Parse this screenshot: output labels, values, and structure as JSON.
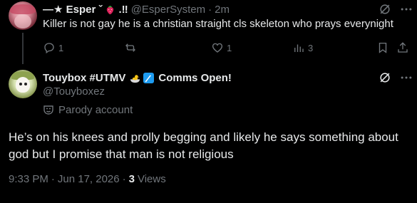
{
  "parent_tweet": {
    "display_name": "—★ Esper ˇ",
    "name_suffix": ".‼",
    "handle": "@EsperSystem",
    "time": "2m",
    "text": "Killer is not gay he is a christian straight cls skeleton who prays everynight",
    "replies": "1",
    "reposts": "",
    "likes": "1",
    "views": "3",
    "icons": {
      "reply": "reply-icon",
      "repost": "repost-icon",
      "like": "like-icon",
      "views": "views-icon",
      "bookmark": "bookmark-icon",
      "share": "share-icon",
      "grok": "grok-icon",
      "more": "more-icon",
      "emoji": "strawberry-icon"
    }
  },
  "main_tweet": {
    "display_name": "Touybox #UTMV",
    "name_suffix": "Comms Open!",
    "handle": "@Touyboxez",
    "label": "Parody account",
    "text": "He’s on his knees and prolly begging and likely he says something about god but I promise that man is not religious",
    "time": "9:33 PM",
    "date": "Jun 17, 2026",
    "views_count": "3",
    "views_label": "Views",
    "icons": {
      "emoji1": "duck-bath-icon",
      "emoji2": "paint-brush-icon",
      "label": "parody-mask-icon",
      "grok": "grok-icon",
      "more": "more-icon"
    }
  },
  "colors": {
    "background": "#000000",
    "text": "#e7e9ea",
    "muted": "#71767b",
    "thread_line": "#333639"
  }
}
